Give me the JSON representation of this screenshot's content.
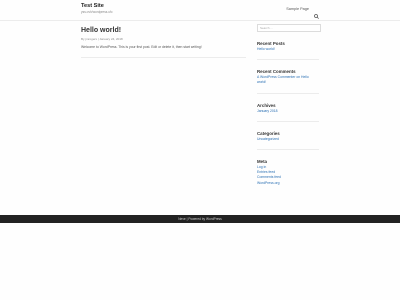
{
  "header": {
    "site_title": "Test Site",
    "tagline": "yss.ovh/wordpress.ufc",
    "nav_link": "Sample Page",
    "search_icon": "search-icon"
  },
  "post": {
    "title": "Hello world!",
    "author": "By jmrogers",
    "date": "January 24, 2018",
    "body": "Welcome to WordPress. This is your first post. Edit or delete it, then start writing!"
  },
  "sidebar": {
    "search_placeholder": "Search ...",
    "recent_posts": {
      "title": "Recent Posts",
      "items": [
        "Hello world!"
      ]
    },
    "recent_comments": {
      "title": "Recent Comments",
      "line1": "A WordPress Commenter on Hello",
      "line2": "world!"
    },
    "archives": {
      "title": "Archives",
      "items": [
        "January 2018"
      ]
    },
    "categories": {
      "title": "Categories",
      "items": [
        "Uncategorized"
      ]
    },
    "meta": {
      "title": "Meta",
      "items": [
        "Log in",
        "Entries feed",
        "Comments feed",
        "WordPress.org"
      ]
    }
  },
  "footer": {
    "left": "Neve",
    "sep": " | ",
    "right": "Powered by WordPress"
  },
  "colors": {
    "link": "#2a6fb3",
    "footer_bg": "#222222"
  }
}
